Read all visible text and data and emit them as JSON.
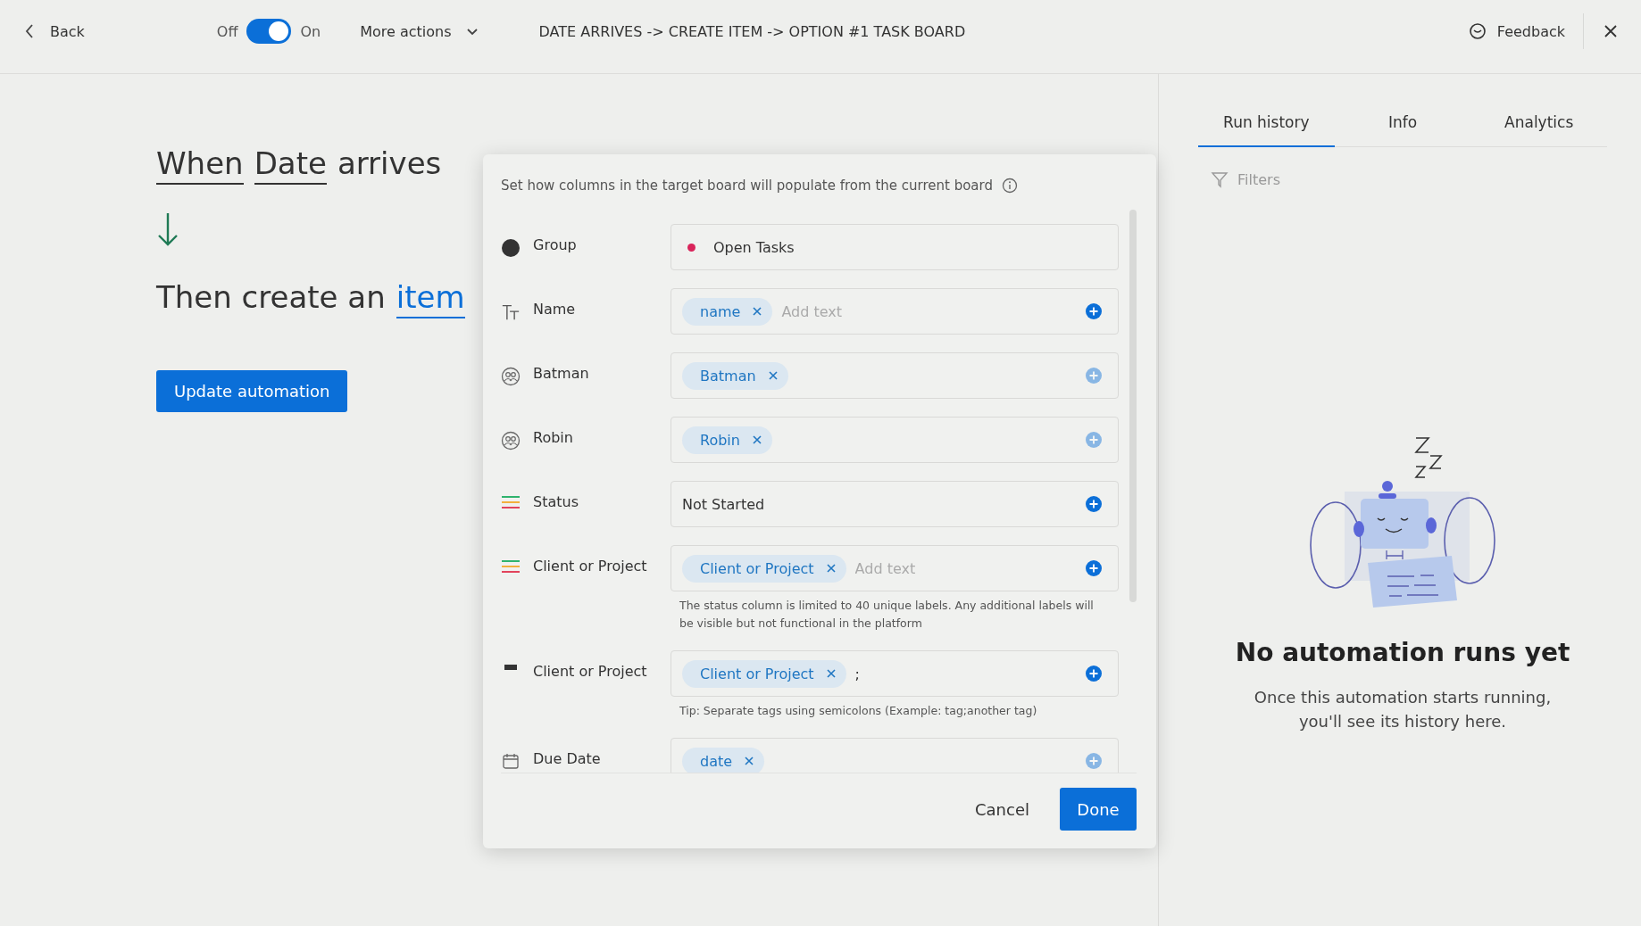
{
  "top_bar": {
    "back": "Back",
    "toggle": {
      "off_label": "Off",
      "on_label": "On",
      "on": true
    },
    "more_actions": "More actions",
    "title": "DATE ARRIVES -> CREATE ITEM -> OPTION #1 TASK BOARD",
    "feedback": "Feedback"
  },
  "recipe": {
    "trigger": [
      {
        "text": "When",
        "kind": "underlined"
      },
      {
        "text": "Date",
        "kind": "underlined"
      },
      {
        "text": "arrives",
        "kind": "plain"
      }
    ],
    "action": [
      {
        "text": "Then create an",
        "kind": "plain"
      },
      {
        "text": "item",
        "kind": "link"
      }
    ],
    "update_button": "Update automation"
  },
  "modal": {
    "description": "Set how columns in the target board will populate from the current board",
    "rows": [
      {
        "kind": "group",
        "label": "Group",
        "value": "Open Tasks",
        "color": "#d9245a"
      },
      {
        "kind": "text",
        "label": "Name",
        "chips": [
          "name"
        ],
        "placeholder": "Add text",
        "disabled": false
      },
      {
        "kind": "people",
        "label": "Batman",
        "chips": [
          "Batman"
        ],
        "disabled": true
      },
      {
        "kind": "people",
        "label": "Robin",
        "chips": [
          "Robin"
        ],
        "disabled": true
      },
      {
        "kind": "status",
        "label": "Status",
        "value": "Not Started",
        "disabled": false
      },
      {
        "kind": "status",
        "label": "Client or Project",
        "chips": [
          "Client or Project"
        ],
        "placeholder": "Add text",
        "disabled": false,
        "note": "The status column is limited to 40 unique labels. Any additional labels will be visible but not functional in the platform"
      },
      {
        "kind": "dropdown",
        "label": "Client or Project",
        "chips": [
          "Client or Project"
        ],
        "value": ";",
        "disabled": false,
        "note": "Tip: Separate tags using semicolons (Example: tag;another tag)"
      },
      {
        "kind": "date",
        "label": "Due Date",
        "chips": [
          "date"
        ],
        "disabled": true
      }
    ],
    "cancel": "Cancel",
    "done": "Done"
  },
  "panel": {
    "tabs": [
      {
        "label": "Run history",
        "selected": true
      },
      {
        "label": "Info",
        "selected": false
      },
      {
        "label": "Analytics",
        "selected": false
      }
    ],
    "filters": "Filters",
    "empty_title": "No automation runs yet",
    "empty_lines": [
      "Once this automation starts running,",
      "you'll see its history here."
    ]
  }
}
